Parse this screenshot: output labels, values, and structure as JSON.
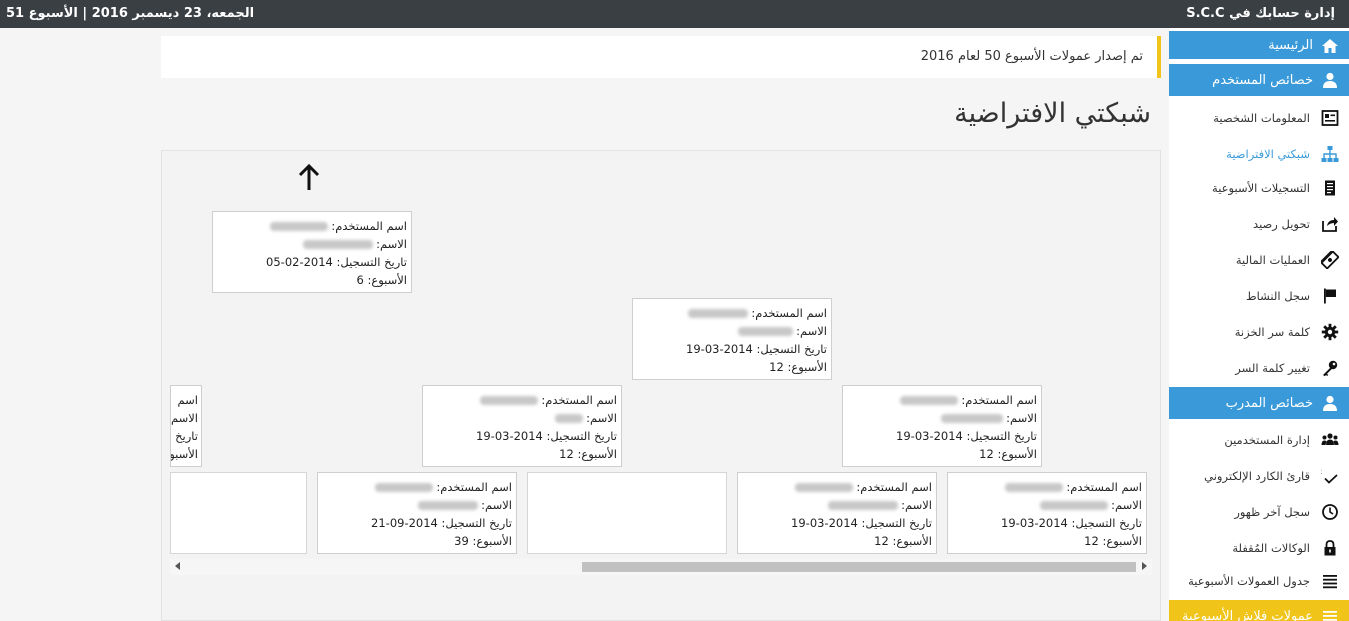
{
  "topbar": {
    "brand": "إدارة حسابك في S.C.C",
    "date": "الجمعه، 23 ديسمبر 2016 | الأسبوع 51"
  },
  "sidebar": {
    "home": "الرئيسية",
    "user_section": "خصائص المستخدم",
    "user_items": [
      {
        "label": "المعلومات الشخصية",
        "icon": "id-card-icon"
      },
      {
        "label": "شبكتي الافتراضية",
        "icon": "network-icon"
      },
      {
        "label": "التسجيلات الأسبوعية",
        "icon": "document-icon"
      },
      {
        "label": "تحويل رصيد",
        "icon": "share-icon"
      },
      {
        "label": "العمليات المالية",
        "icon": "money-icon"
      },
      {
        "label": "سجل النشاط",
        "icon": "flag-icon"
      },
      {
        "label": "كلمة سر الخزنة",
        "icon": "gear-icon"
      },
      {
        "label": "تغيير كلمة السر",
        "icon": "key-icon"
      }
    ],
    "trainer_section": "خصائص المدرب",
    "trainer_items": [
      {
        "label": "إدارة المستخدمين",
        "icon": "users-icon"
      },
      {
        "label": "قارئ الكارد الإلكتروني",
        "icon": "spellcheck-icon"
      },
      {
        "label": "سجل آخر ظهور",
        "icon": "clock-icon"
      },
      {
        "label": "الوكالات المُقفلة",
        "icon": "lock-icon"
      },
      {
        "label": "جدول العمولات الأسبوعية",
        "icon": "list-icon"
      }
    ],
    "flash_section": "عمولات فلاش الأسبوعية"
  },
  "notice": "تم إصدار عمولات الأسبوع 50 لعام 2016",
  "page_title": "شبكتي الافتراضية",
  "labels": {
    "username": "اسم المستخدم:",
    "name": "الاسم:",
    "reg_date": "تاريخ التسجيل:",
    "week": "الأسبوع:",
    "user_short": "اسم",
    "name_short": "الاسم",
    "date_short": "تاريخ",
    "week_short": "الأسبو"
  },
  "nodes": [
    {
      "date": "2014-02-05",
      "week": "6"
    },
    {
      "date": "2014-03-19",
      "week": "12"
    },
    {
      "date": "2014-03-19",
      "week": "12"
    },
    {
      "date": "2014-03-19",
      "week": "12"
    },
    {
      "date": "2014-09-21",
      "week": "39"
    },
    {
      "date": "2014-03-19",
      "week": "12"
    },
    {
      "date": "2014-03-19",
      "week": "12"
    }
  ],
  "colors": {
    "topbar": "#3a3f44",
    "accent": "#3a9ad9",
    "warning": "#f0c419"
  }
}
